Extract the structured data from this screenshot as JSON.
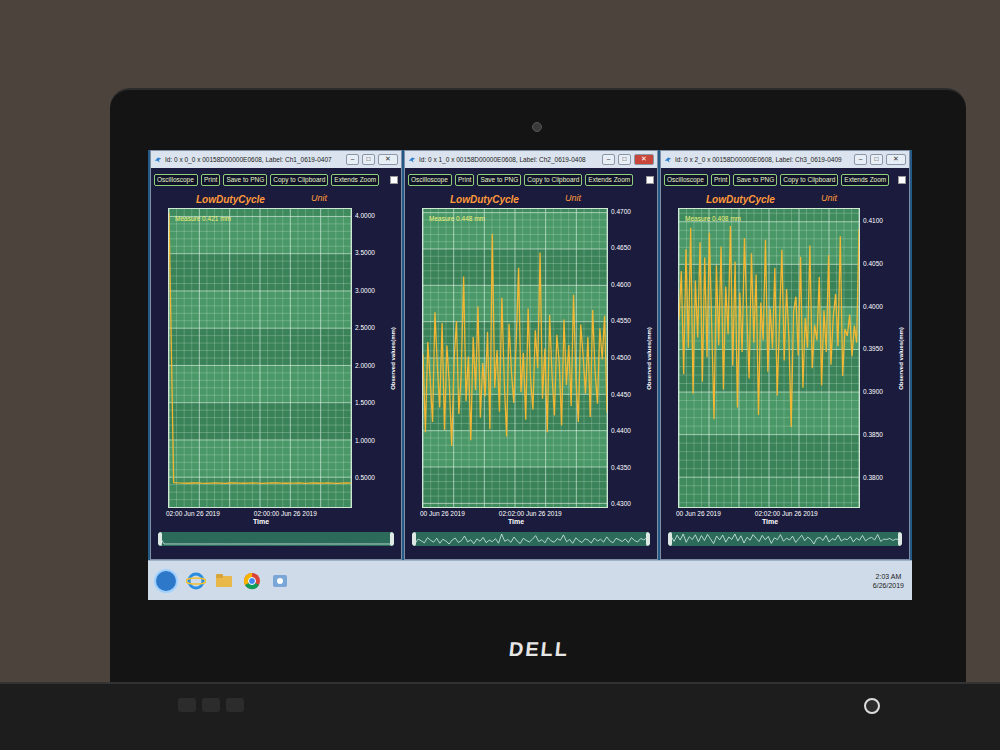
{
  "window_controls": [
    "–",
    "□",
    "✕"
  ],
  "windows": [
    {
      "title": "Id: 0 x 0_0 x 00158D00000E0608, Label: Ch1_0619-0407",
      "active": false,
      "toolbar": [
        "Oscilloscope",
        "Print",
        "Save to PNG",
        "Copy to Clipboard",
        "Extends Zoom"
      ],
      "zoom_checkbox": false,
      "chart_title": "LowDutyCycle",
      "unit": "Unit",
      "measure": "Measure 0.421 mm",
      "y_axis": {
        "title": "Observed values(mm)",
        "ticks": [
          "4.0000",
          "3.5000",
          "3.0000",
          "2.5000",
          "2.0000",
          "1.5000",
          "1.0000",
          "0.5000"
        ],
        "range": [
          0.1,
          4.1
        ]
      },
      "x_axis": {
        "title": "Time",
        "ticks": [
          "02:00 Jun 26 2019",
          "02:00:00 Jun 26 2019"
        ]
      },
      "series": [
        4.05,
        0.428,
        0.423,
        0.421,
        0.419,
        0.422,
        0.424,
        0.42,
        0.418,
        0.421,
        0.423,
        0.42,
        0.417,
        0.422,
        0.425,
        0.421,
        0.419,
        0.42,
        0.423,
        0.421,
        0.418,
        0.42,
        0.422,
        0.424,
        0.421,
        0.419,
        0.421,
        0.42,
        0.423,
        0.418,
        0.421,
        0.422,
        0.419,
        0.42,
        0.424,
        0.421,
        0.418,
        0.42,
        0.422,
        0.421
      ]
    },
    {
      "title": "Id: 0 x 1_0 x 00158D00000E0608, Label: Ch2_0619-0408",
      "active": true,
      "toolbar": [
        "Oscilloscope",
        "Print",
        "Save to PNG",
        "Copy to Clipboard",
        "Extends Zoom"
      ],
      "zoom_checkbox": false,
      "chart_title": "LowDutyCycle",
      "unit": "Unit",
      "measure": "Measure 0.448 mm",
      "y_axis": {
        "title": "Observed values(mm)",
        "ticks": [
          "0.4700",
          "0.4650",
          "0.4600",
          "0.4550",
          "0.4500",
          "0.4450",
          "0.4400",
          "0.4350",
          "0.4300"
        ],
        "range": [
          0.4295,
          0.4705
        ]
      },
      "x_axis": {
        "title": "Time",
        "ticks": [
          "00 Jun 26 2019",
          "02:02:00 Jun 26 2019"
        ]
      },
      "series": [
        0.4505,
        0.4398,
        0.4522,
        0.4471,
        0.4412,
        0.4563,
        0.4489,
        0.4432,
        0.4548,
        0.4401,
        0.4517,
        0.4466,
        0.4379,
        0.4495,
        0.4551,
        0.4423,
        0.4478,
        0.4612,
        0.4441,
        0.4502,
        0.4387,
        0.4529,
        0.4456,
        0.4571,
        0.4418,
        0.4493,
        0.4447,
        0.4536,
        0.4402,
        0.4671,
        0.4459,
        0.4511,
        0.4426,
        0.4583,
        0.4468,
        0.4392,
        0.4547,
        0.4481,
        0.4438,
        0.4521,
        0.4624,
        0.4453,
        0.4507,
        0.4415,
        0.4568,
        0.4472,
        0.4429,
        0.4538,
        0.4486,
        0.4645,
        0.4444,
        0.4513,
        0.4398,
        0.4559,
        0.4476,
        0.4421,
        0.4532,
        0.4494,
        0.4407,
        0.4553,
        0.4463,
        0.4518,
        0.4434,
        0.4587,
        0.4471,
        0.4412,
        0.4546,
        0.4503,
        0.4451,
        0.4529,
        0.4419,
        0.4566,
        0.4482,
        0.4437,
        0.4541,
        0.4498,
        0.4558,
        0.4425
      ]
    },
    {
      "title": "Id: 0 x 2_0 x 00158D00000E0608, Label: Ch3_0619-0409",
      "active": false,
      "toolbar": [
        "Oscilloscope",
        "Print",
        "Save to PNG",
        "Copy to Clipboard",
        "Extends Zoom"
      ],
      "zoom_checkbox": false,
      "chart_title": "LowDutyCycle",
      "unit": "Unit",
      "measure": "Measure 0.408 mm",
      "y_axis": {
        "title": "Observed values(mm)",
        "ticks": [
          "0.4100",
          "0.4050",
          "0.4000",
          "0.3950",
          "0.3900",
          "0.3850",
          "0.3800"
        ],
        "range": [
          0.3765,
          0.4115
        ]
      },
      "x_axis": {
        "title": "Time",
        "ticks": [
          "00 Jun 26 2019",
          "02:02:00 Jun 26 2019"
        ]
      },
      "series": [
        0.3985,
        0.4042,
        0.3921,
        0.4068,
        0.3952,
        0.4093,
        0.3898,
        0.4031,
        0.3964,
        0.4076,
        0.3912,
        0.4058,
        0.3941,
        0.4087,
        0.3976,
        0.3868,
        0.4049,
        0.3955,
        0.4071,
        0.3903,
        0.4024,
        0.3968,
        0.4095,
        0.3931,
        0.4053,
        0.3882,
        0.4017,
        0.3947,
        0.4081,
        0.3992,
        0.3916,
        0.4063,
        0.3958,
        0.4038,
        0.3873,
        0.4005,
        0.3961,
        0.4079,
        0.3924,
        0.3998,
        0.3951,
        0.4046,
        0.3896,
        0.3983,
        0.4067,
        0.3937,
        0.4021,
        0.3965,
        0.3859,
        0.3994,
        0.4012,
        0.3943,
        0.4059,
        0.3905,
        0.3987,
        0.3952,
        0.4072,
        0.3928,
        0.3979,
        0.3961,
        0.4035,
        0.3908,
        0.3996,
        0.3947,
        0.4061,
        0.3932,
        0.3989,
        0.4015,
        0.3954,
        0.4083,
        0.3919,
        0.3974,
        0.3966,
        0.3991,
        0.3942,
        0.3978,
        0.3958,
        0.4091
      ]
    }
  ],
  "taskbar": {
    "clock": {
      "time": "2:03 AM",
      "date": "6/26/2019"
    }
  },
  "laptop": {
    "brand": "DELL"
  }
}
